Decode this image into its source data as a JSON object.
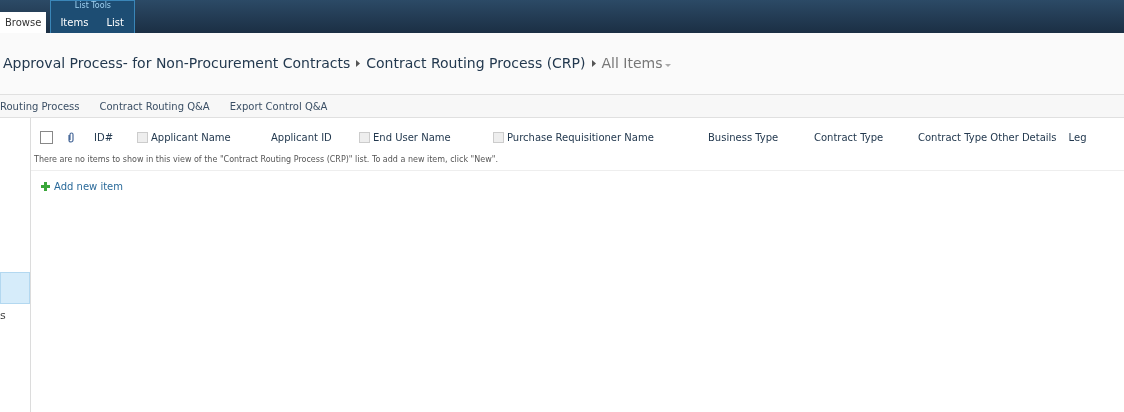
{
  "ribbon": {
    "tabs": [
      {
        "label": "Browse",
        "selected": true
      }
    ],
    "contextual_group": {
      "title": "List Tools",
      "tabs": [
        {
          "label": "Items",
          "selected": false
        },
        {
          "label": "List",
          "selected": false
        }
      ]
    }
  },
  "breadcrumb": {
    "site": "Approval Process- for Non-Procurement Contracts",
    "list": "Contract Routing Process (CRP)",
    "view": "All Items"
  },
  "top_nav": [
    "Routing Process",
    "Contract Routing Q&A",
    "Export Control Q&A"
  ],
  "sidebar": {
    "items": [
      {
        "selected": true
      },
      {
        "label": "s",
        "selected": false
      }
    ]
  },
  "table": {
    "columns": [
      {
        "kind": "select",
        "checked": false
      },
      {
        "kind": "attachment"
      },
      {
        "kind": "text",
        "label": "ID#"
      },
      {
        "kind": "flagged",
        "label": "Applicant Name"
      },
      {
        "kind": "text",
        "label": "Applicant ID"
      },
      {
        "kind": "flagged",
        "label": "End User Name"
      },
      {
        "kind": "flagged",
        "label": "Purchase Requisitioner Name"
      },
      {
        "kind": "text",
        "label": "Business Type"
      },
      {
        "kind": "text",
        "label": "Contract Type"
      },
      {
        "kind": "text",
        "label": "Contract Type Other Details"
      },
      {
        "kind": "text",
        "label": "Leg"
      }
    ],
    "empty_message": "There are no items to show in this view of the \"Contract Routing Process (CRP)\" list. To add a new item, click \"New\".",
    "add_link": "Add new item"
  }
}
